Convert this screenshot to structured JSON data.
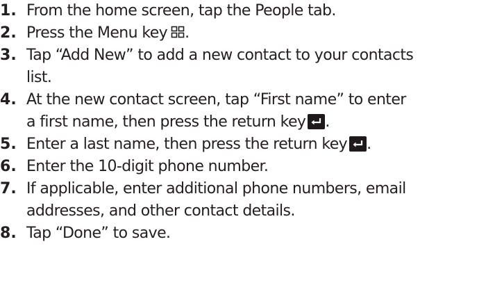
{
  "steps": [
    {
      "number": "1",
      "text": "From the home screen, tap the People tab."
    },
    {
      "number": "2",
      "text": "Press the Menu key",
      "icon": "menu-key-icon",
      "suffix": "."
    },
    {
      "number": "3",
      "line1": "Tap “Add New” to add a new contact to your contacts",
      "line2": "list."
    },
    {
      "number": "4",
      "line1": "At the new contact screen, tap “First name” to enter",
      "line2": "a first name, then press the return key",
      "icon": "return-key-icon",
      "suffix": "."
    },
    {
      "number": "5",
      "text": "Enter a last name, then press the return key",
      "icon": "return-key-icon",
      "suffix": "."
    },
    {
      "number": "6",
      "text": "Enter the 10-digit phone number."
    },
    {
      "number": "7",
      "line1": "If applicable, enter additional phone numbers, email",
      "line2": "addresses, and other contact details."
    },
    {
      "number": "8",
      "text": "Tap “Done” to save."
    }
  ],
  "colors": {
    "text": "#231f20",
    "key_background": "#1e1a1b",
    "key_glyph": "#ffffff"
  }
}
